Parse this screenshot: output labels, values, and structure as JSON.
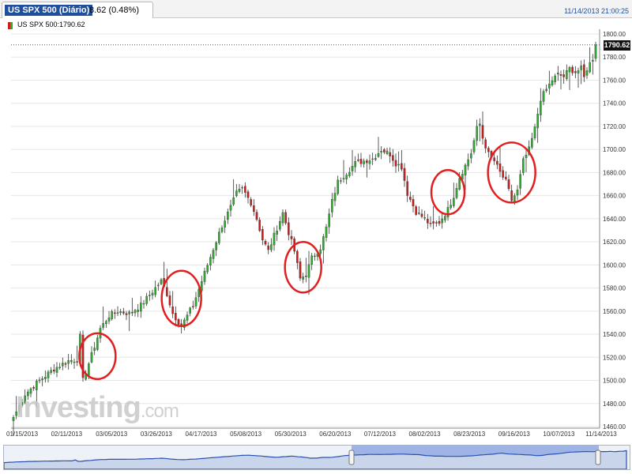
{
  "header": {
    "symbol": "US SPX 500 (Diário)",
    "change": "8.62 (0.48%)",
    "datetime": "11/14/2013 21:00:25"
  },
  "legend": {
    "label": "US SPX 500:1790.62"
  },
  "price_tag": "1790.62",
  "watermark": {
    "main": "Investing",
    "suffix": ".com"
  },
  "colors": {
    "up": "#2ea82e",
    "down": "#c81e1e",
    "circle": "#e02020",
    "axis": "#888888",
    "grid": "#e6e6e6"
  },
  "chart_data": {
    "type": "candlestick",
    "title": "US SPX 500 (Diário)",
    "last_value": 1790.62,
    "ylim": [
      1460,
      1800
    ],
    "yticks": [
      1460,
      1480,
      1500,
      1520,
      1540,
      1560,
      1580,
      1600,
      1620,
      1640,
      1660,
      1680,
      1700,
      1720,
      1740,
      1760,
      1780,
      1800
    ],
    "ytick_labels": [
      "1460.00",
      "1480.00",
      "1500.00",
      "1520.00",
      "1540.00",
      "1560.00",
      "1580.00",
      "1600.00",
      "1620.00",
      "1640.00",
      "1660.00",
      "1680.00",
      "1700.00",
      "1720.00",
      "1740.00",
      "1760.00",
      "1780.00",
      "1800.00"
    ],
    "xtick_labels": [
      "01/15/2013",
      "02/11/2013",
      "03/05/2013",
      "03/26/2013",
      "04/17/2013",
      "05/08/2013",
      "05/30/2013",
      "06/20/2013",
      "07/12/2013",
      "08/02/2013",
      "08/23/2013",
      "09/16/2013",
      "10/07/2013",
      "11/14/2013"
    ],
    "anchors": [
      {
        "i": 0,
        "v": 1468
      },
      {
        "i": 4,
        "v": 1488
      },
      {
        "i": 9,
        "v": 1500
      },
      {
        "i": 14,
        "v": 1510
      },
      {
        "i": 19,
        "v": 1517
      },
      {
        "i": 22,
        "v": 1518
      },
      {
        "i": 23,
        "v": 1538
      },
      {
        "i": 24,
        "v": 1500
      },
      {
        "i": 27,
        "v": 1522
      },
      {
        "i": 30,
        "v": 1545
      },
      {
        "i": 33,
        "v": 1556
      },
      {
        "i": 36,
        "v": 1560
      },
      {
        "i": 40,
        "v": 1558
      },
      {
        "i": 44,
        "v": 1565
      },
      {
        "i": 48,
        "v": 1577
      },
      {
        "i": 51,
        "v": 1586
      },
      {
        "i": 53,
        "v": 1575
      },
      {
        "i": 55,
        "v": 1558
      },
      {
        "i": 58,
        "v": 1547
      },
      {
        "i": 62,
        "v": 1565
      },
      {
        "i": 66,
        "v": 1593
      },
      {
        "i": 69,
        "v": 1614
      },
      {
        "i": 72,
        "v": 1634
      },
      {
        "i": 75,
        "v": 1650
      },
      {
        "i": 77,
        "v": 1662
      },
      {
        "i": 79,
        "v": 1666
      },
      {
        "i": 82,
        "v": 1654
      },
      {
        "i": 84,
        "v": 1640
      },
      {
        "i": 86,
        "v": 1622
      },
      {
        "i": 88,
        "v": 1612
      },
      {
        "i": 91,
        "v": 1632
      },
      {
        "i": 93,
        "v": 1645
      },
      {
        "i": 95,
        "v": 1628
      },
      {
        "i": 97,
        "v": 1612
      },
      {
        "i": 99,
        "v": 1588
      },
      {
        "i": 101,
        "v": 1592
      },
      {
        "i": 103,
        "v": 1606
      },
      {
        "i": 106,
        "v": 1615
      },
      {
        "i": 108,
        "v": 1632
      },
      {
        "i": 110,
        "v": 1655
      },
      {
        "i": 112,
        "v": 1672
      },
      {
        "i": 115,
        "v": 1680
      },
      {
        "i": 118,
        "v": 1688
      },
      {
        "i": 121,
        "v": 1690
      },
      {
        "i": 124,
        "v": 1692
      },
      {
        "i": 127,
        "v": 1700
      },
      {
        "i": 130,
        "v": 1696
      },
      {
        "i": 132,
        "v": 1688
      },
      {
        "i": 134,
        "v": 1685
      },
      {
        "i": 136,
        "v": 1662
      },
      {
        "i": 139,
        "v": 1646
      },
      {
        "i": 142,
        "v": 1640
      },
      {
        "i": 144,
        "v": 1634
      },
      {
        "i": 147,
        "v": 1637
      },
      {
        "i": 150,
        "v": 1648
      },
      {
        "i": 152,
        "v": 1660
      },
      {
        "i": 154,
        "v": 1676
      },
      {
        "i": 156,
        "v": 1686
      },
      {
        "i": 158,
        "v": 1697
      },
      {
        "i": 160,
        "v": 1718
      },
      {
        "i": 161,
        "v": 1722
      },
      {
        "i": 162,
        "v": 1710
      },
      {
        "i": 164,
        "v": 1696
      },
      {
        "i": 166,
        "v": 1690
      },
      {
        "i": 168,
        "v": 1680
      },
      {
        "i": 170,
        "v": 1672
      },
      {
        "i": 172,
        "v": 1656
      },
      {
        "i": 174,
        "v": 1664
      },
      {
        "i": 176,
        "v": 1690
      },
      {
        "i": 178,
        "v": 1700
      },
      {
        "i": 180,
        "v": 1718
      },
      {
        "i": 182,
        "v": 1744
      },
      {
        "i": 184,
        "v": 1752
      },
      {
        "i": 186,
        "v": 1760
      },
      {
        "i": 188,
        "v": 1765
      },
      {
        "i": 190,
        "v": 1763
      },
      {
        "i": 192,
        "v": 1770
      },
      {
        "i": 194,
        "v": 1767
      },
      {
        "i": 196,
        "v": 1770
      },
      {
        "i": 197,
        "v": 1762
      },
      {
        "i": 198,
        "v": 1770
      },
      {
        "i": 200,
        "v": 1779
      },
      {
        "i": 201,
        "v": 1790.62
      }
    ],
    "annotations": [
      {
        "type": "circle",
        "i": 29,
        "v": 1521,
        "rx_px": 23,
        "ry_px": 29
      },
      {
        "type": "circle",
        "i": 58,
        "v": 1571,
        "rx_px": 25,
        "ry_px": 35
      },
      {
        "type": "circle",
        "i": 100,
        "v": 1598,
        "rx_px": 23,
        "ry_px": 32
      },
      {
        "type": "circle",
        "i": 150,
        "v": 1663,
        "rx_px": 21,
        "ry_px": 28
      },
      {
        "type": "circle",
        "i": 172,
        "v": 1680,
        "rx_px": 30,
        "ry_px": 38
      }
    ]
  }
}
